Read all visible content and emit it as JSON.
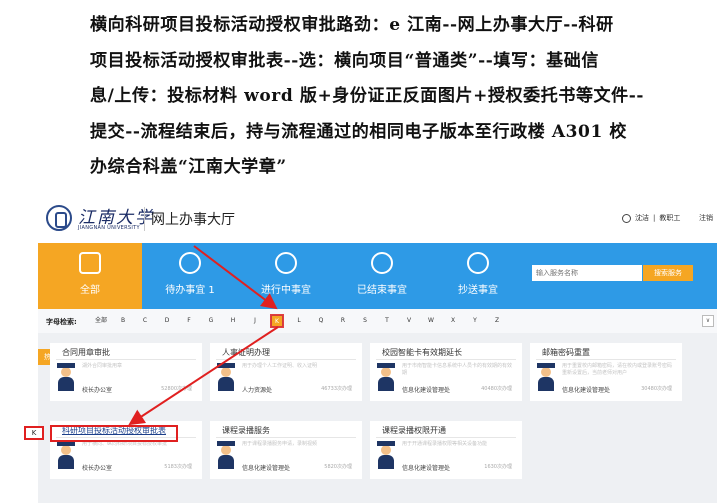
{
  "instructions": {
    "line1": "横向科研项目投标活动授权审批路劲：e 江南--网上办事大厅--科研",
    "line2": "项目投标活动授权审批表--选：横向项目“普通类”--填写：基础信",
    "line3": "息/上传：投标材料 word 版+身份证正反面图片+授权委托书等文件--",
    "line4": "提交--流程结束后，持与流程通过的相同电子版本至行政楼 A301 校",
    "line5": "办综合科盖“江南大学章”"
  },
  "header": {
    "logo_cn": "江南大学",
    "logo_en": "JIANGNAN UNIVERSITY",
    "site_title": "网上办事大厅",
    "user_name": "沈洁",
    "user_role": "教职工",
    "logout": "注销"
  },
  "hero": {
    "tiles": [
      {
        "label": "全部",
        "icon": "grid-icon"
      },
      {
        "label": "待办事宜 1",
        "icon": "clock-icon"
      },
      {
        "label": "进行中事宜",
        "icon": "progress-icon"
      },
      {
        "label": "已结束事宜",
        "icon": "check-icon"
      },
      {
        "label": "抄送事宜",
        "icon": "send-icon"
      }
    ],
    "search_placeholder": "输入服务名称",
    "search_button": "搜索服务"
  },
  "alpha": {
    "label": "字母检索:",
    "letters": [
      "全部",
      "B",
      "C",
      "D",
      "F",
      "G",
      "H",
      "J",
      "K",
      "L",
      "Q",
      "R",
      "S",
      "T",
      "V",
      "W",
      "X",
      "Y",
      "Z"
    ],
    "active": "K",
    "expand": "∨"
  },
  "hot_tab": "热门事项",
  "k_marker": "K",
  "cards": [
    {
      "title": "合同用章审批",
      "desc": "湖外合同审批用章",
      "dept": "校长办公室",
      "count": "52800次办理"
    },
    {
      "title": "人事证明办理",
      "desc": "用于办理个人工作证明、收入证明",
      "dept": "人力资源处",
      "count": "46733次办理"
    },
    {
      "title": "校园智能卡有效期延长",
      "desc": "用于市南智能卡信息系统中人员卡的有效期的有效期",
      "dept": "信息化建设管理处",
      "count": "40480次办理"
    },
    {
      "title": "邮箱密码重置",
      "desc": "用于重置校内邮箱密码，请在校内或登录账号密码重新设置后，当前老师对用户",
      "dept": "信息化建设管理处",
      "count": "30480次办理"
    },
    {
      "title": "科研项目投标活动授权审批表",
      "desc": "用于横向、纵向科研项目投标授权审批",
      "dept": "校长办公室",
      "count": "5183次办理"
    },
    {
      "title": "课程录播服务",
      "desc": "用于课程录播服务申请，录制视频",
      "dept": "信息化建设管理处",
      "count": "5820次办理"
    },
    {
      "title": "课程录播权限开通",
      "desc": "用于开通课程录播权限等相关设备功能",
      "dept": "信息化建设管理处",
      "count": "1630次办理"
    }
  ]
}
